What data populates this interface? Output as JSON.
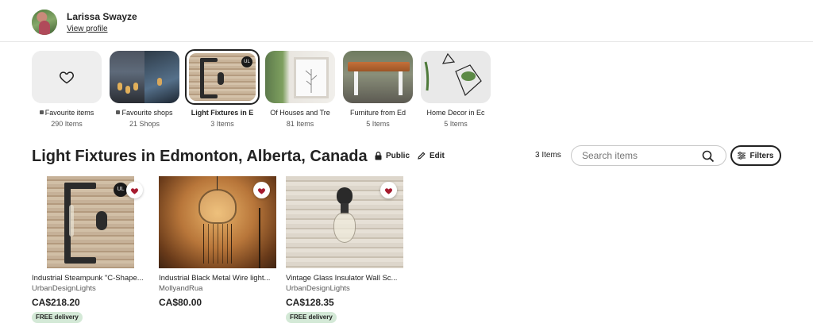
{
  "profile": {
    "name": "Larissa Swayze",
    "view_profile": "View profile"
  },
  "collections": [
    {
      "name": "Favourite items",
      "count": "290 Items",
      "icon": "heart-icon",
      "locked": true
    },
    {
      "name": "Favourite shops",
      "count": "21 Shops",
      "locked": true
    },
    {
      "name": "Light Fixtures in E",
      "count": "3 Items",
      "active": true
    },
    {
      "name": "Of Houses and Tre",
      "count": "81 Items"
    },
    {
      "name": "Furniture from Ed",
      "count": "5 Items"
    },
    {
      "name": "Home Decor in Ec",
      "count": "5 Items"
    }
  ],
  "collection_title": "Light Fixtures in Edmonton, Alberta, Canada",
  "visibility": {
    "label": "Public",
    "icon": "lock-icon"
  },
  "edit": {
    "label": "Edit",
    "icon": "pencil-icon"
  },
  "items_count": "3 Items",
  "search": {
    "placeholder": "Search items",
    "icon": "search-icon"
  },
  "filters": {
    "label": "Filters",
    "icon": "sliders-icon"
  },
  "listings": [
    {
      "title": "Industrial Steampunk \"C-Shape...",
      "shop": "UrbanDesignLights",
      "price": "CA$218.20",
      "badge": "FREE delivery"
    },
    {
      "title": "Industrial Black Metal Wire light...",
      "shop": "MollyandRua",
      "price": "CA$80.00"
    },
    {
      "title": "Vintage Glass Insulator Wall Sc...",
      "shop": "UrbanDesignLights",
      "price": "CA$128.35",
      "badge": "FREE delivery"
    }
  ],
  "colors": {
    "favorite_heart": "#a61a2e",
    "free_badge": "#d4e9d7",
    "text": "#222222"
  }
}
